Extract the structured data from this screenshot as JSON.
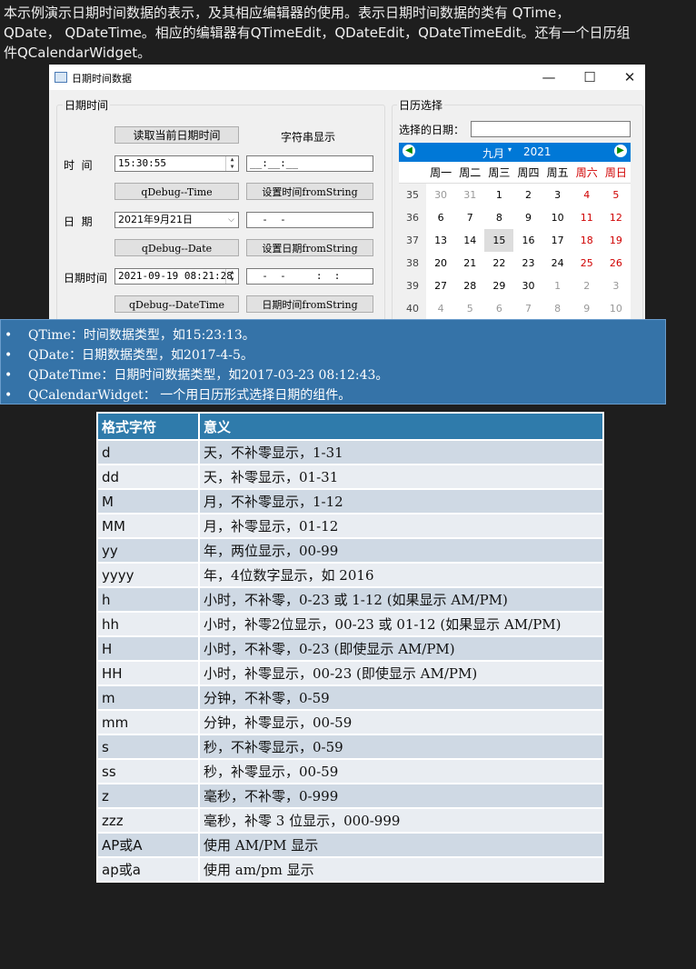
{
  "intro": {
    "line1": "本示例演示日期时间数据的表示，及其相应编辑器的使用。表示日期时间数据的类有 QTime，",
    "line2": "QDate， QDateTime。相应的编辑器有QTimeEdit，QDateEdit，QDateTimeEdit。还有一个日历组",
    "line3": "件QCalendarWidget。"
  },
  "window": {
    "title": "日期时间数据",
    "minimize": "—",
    "maximize": "☐",
    "close": "✕"
  },
  "left_group": {
    "title": "日期时间",
    "read_button": "读取当前日期时间",
    "string_display_label": "字符串显示",
    "time_label": "时  间",
    "time_value": "15:30:55",
    "time_string": "__:__:__",
    "debug_time_button": "qDebug--Time",
    "set_time_button": "设置时间fromString",
    "date_label": "日  期",
    "date_value": "2021年9月21日",
    "date_string": "  -  -",
    "debug_date_button": "qDebug--Date",
    "set_date_button": "设置日期fromString",
    "datetime_label": "日期时间",
    "datetime_value": "2021-09-19 08:21:28",
    "datetime_string": "  -  -     :  :",
    "debug_datetime_button": "qDebug--DateTime",
    "set_datetime_button": "日期时间fromString"
  },
  "calendar_group": {
    "title": "日历选择",
    "selected_label": "选择的日期：",
    "selected_value": "",
    "month": "九月",
    "year": "2021",
    "weekdays": [
      "周一",
      "周二",
      "周三",
      "周四",
      "周五",
      "周六",
      "周日"
    ],
    "weeks": [
      {
        "wk": "35",
        "days": [
          "30",
          "31",
          "1",
          "2",
          "3",
          "4",
          "5"
        ]
      },
      {
        "wk": "36",
        "days": [
          "6",
          "7",
          "8",
          "9",
          "10",
          "11",
          "12"
        ]
      },
      {
        "wk": "37",
        "days": [
          "13",
          "14",
          "15",
          "16",
          "17",
          "18",
          "19"
        ]
      },
      {
        "wk": "38",
        "days": [
          "20",
          "21",
          "22",
          "23",
          "24",
          "25",
          "26"
        ]
      },
      {
        "wk": "39",
        "days": [
          "27",
          "28",
          "29",
          "30",
          "1",
          "2",
          "3"
        ]
      },
      {
        "wk": "40",
        "days": [
          "4",
          "5",
          "6",
          "7",
          "8",
          "9",
          "10"
        ]
      }
    ],
    "selected_day": "15",
    "weekend_color": "#d00000",
    "accent": "#0078d7"
  },
  "bullets": [
    "QTime：时间数据类型，如15:23:13。",
    "QDate：日期数据类型，如2017-4-5。",
    "QDateTime：日期时间数据类型，如2017-03-23 08:12:43。",
    "QCalendarWidget： 一个用日历形式选择日期的组件。"
  ],
  "format_table": {
    "headers": [
      "格式字符",
      "意义"
    ],
    "rows": [
      [
        "d",
        "天，不补零显示，1-31"
      ],
      [
        "dd",
        "天，补零显示，01-31"
      ],
      [
        "M",
        "月，不补零显示，1-12"
      ],
      [
        "MM",
        "月，补零显示，01-12"
      ],
      [
        "yy",
        "年，两位显示，00-99"
      ],
      [
        "yyyy",
        "年，4位数字显示，如 2016"
      ],
      [
        "h",
        "小时，不补零，0-23 或 1-12 (如果显示 AM/PM)"
      ],
      [
        "hh",
        "小时，补零2位显示，00-23 或 01-12 (如果显示 AM/PM)"
      ],
      [
        "H",
        "小时，不补零，0-23 (即使显示 AM/PM)"
      ],
      [
        "HH",
        "小时，补零显示，00-23 (即使显示 AM/PM)"
      ],
      [
        "m",
        "分钟，不补零，0-59"
      ],
      [
        "mm",
        "分钟，补零显示，00-59"
      ],
      [
        "s",
        "秒，不补零显示，0-59"
      ],
      [
        "ss",
        "秒，补零显示，00-59"
      ],
      [
        "z",
        "毫秒，不补零，0-999"
      ],
      [
        "zzz",
        "毫秒，补零 3 位显示，000-999"
      ],
      [
        "AP或A",
        "使用 AM/PM 显示"
      ],
      [
        "ap或a",
        "使用 am/pm 显示"
      ]
    ]
  }
}
